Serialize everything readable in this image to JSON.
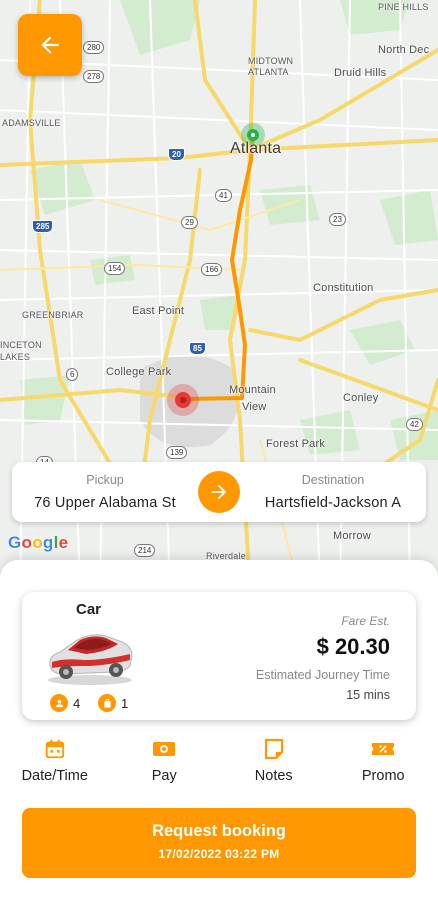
{
  "map": {
    "labels": {
      "north_dec": "North Dec",
      "midtown": "MIDTOWN\nATLANTA",
      "midtown_line1": "MIDTOWN",
      "midtown_line2": "ATLANTA",
      "druid_hills": "Druid Hills",
      "adamsville": "ADAMSVILLE",
      "atlanta": "Atlanta",
      "constitution": "Constitution",
      "east_point": "East Point",
      "greenbriar": "GREENBRIAR",
      "lakes_1": "INCETON",
      "lakes_2": "LAKES",
      "college_park": "College Park",
      "mountain_view_1": "Mountain",
      "mountain_view_2": "View",
      "conley": "Conley",
      "forest_park": "Forest Park",
      "morrow": "Morrow",
      "riverdale": "Riverdale",
      "pine_hills": "PINE HILLS",
      "r1": "R"
    },
    "shields": {
      "s280": "280",
      "s278": "278",
      "s20": "20",
      "s285": "285",
      "s41": "41",
      "s29": "29",
      "s23": "23",
      "s154": "154",
      "s166": "166",
      "s85": "85",
      "s6": "6",
      "s139": "139",
      "s14": "14",
      "s214": "214",
      "s42": "42"
    },
    "attribution": "Google"
  },
  "route": {
    "pickup_label": "Pickup",
    "pickup_value": "76 Upper Alabama St",
    "destination_label": "Destination",
    "destination_value": "Hartsfield-Jackson A"
  },
  "vehicle": {
    "name": "Car",
    "passengers": "4",
    "luggage": "1",
    "fare_label": "Fare Est.",
    "fare_value": "$ 20.30",
    "eta_label": "Estimated Journey Time",
    "eta_value": "15 mins"
  },
  "actions": [
    {
      "label": "Date/Time",
      "icon": "calendar-icon"
    },
    {
      "label": "Pay",
      "icon": "cash-icon"
    },
    {
      "label": "Notes",
      "icon": "note-icon"
    },
    {
      "label": "Promo",
      "icon": "ticket-icon"
    }
  ],
  "request": {
    "title": "Request booking",
    "datetime": "17/02/2022 03:22 PM"
  },
  "colors": {
    "accent": "#ff9800",
    "pickup_marker": "#27b34a",
    "dest_marker": "#e53935",
    "car": "#d32f2f"
  }
}
